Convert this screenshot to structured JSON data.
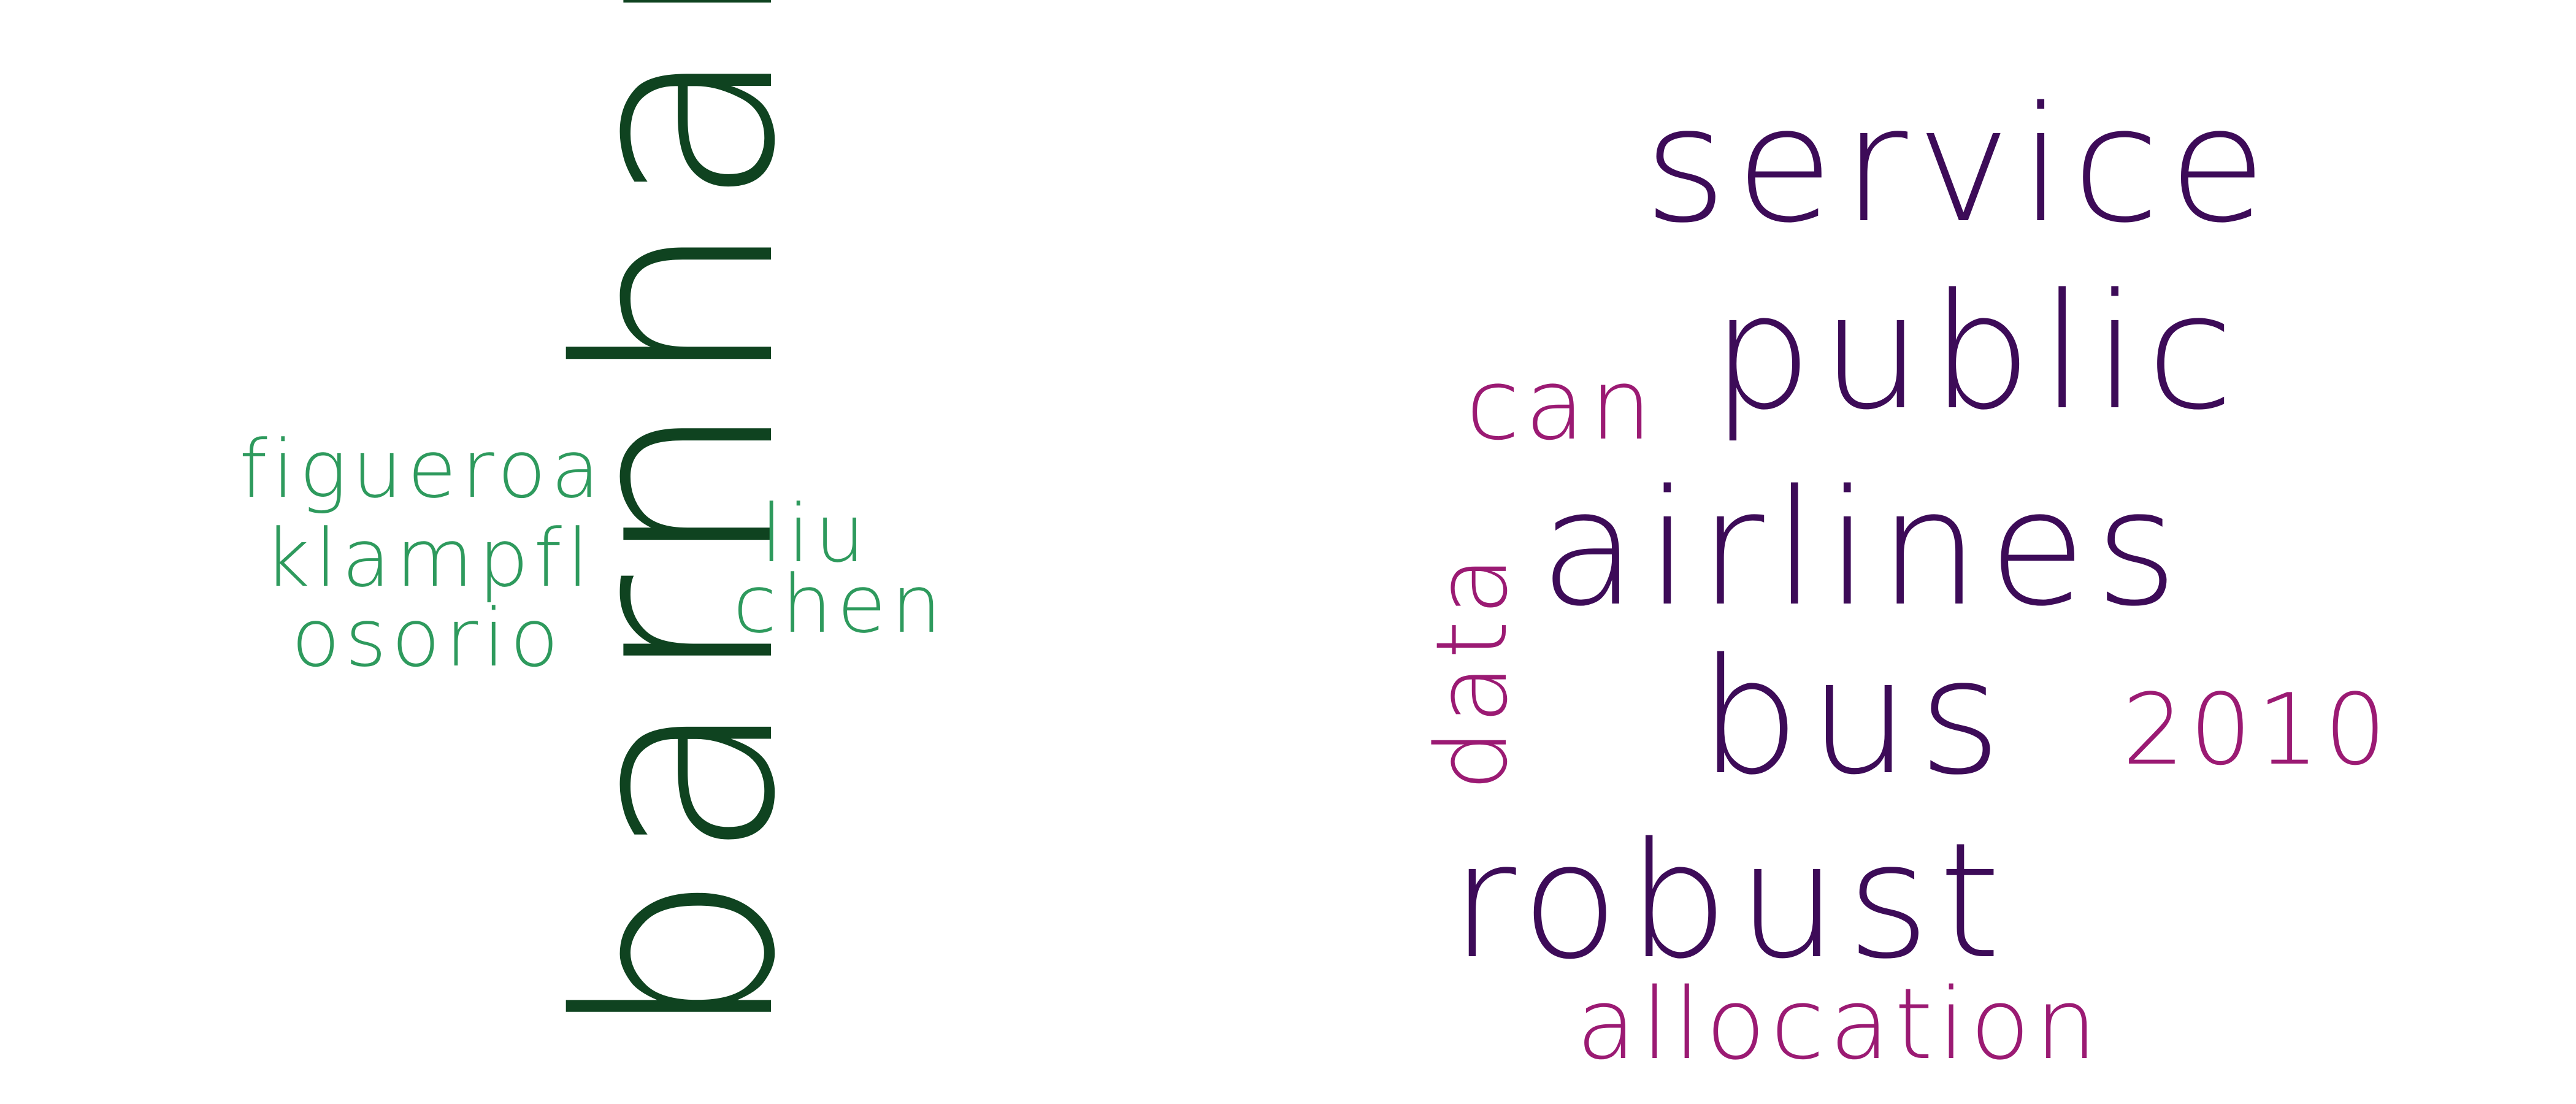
{
  "authors": {
    "primary": "barnhart",
    "secondary": [
      "figueroa",
      "klampfl",
      "osorio",
      "liu",
      "chen"
    ]
  },
  "terms": {
    "primary": [
      "service",
      "public",
      "airlines",
      "bus",
      "robust"
    ],
    "secondary": [
      "can",
      "data",
      "2010",
      "allocation"
    ]
  },
  "colors": {
    "author_primary": "#0f4320",
    "author_secondary": "#2e9a5d",
    "term_primary": "#3d0b58",
    "term_secondary": "#9b1a73",
    "background": "#ffffff"
  }
}
